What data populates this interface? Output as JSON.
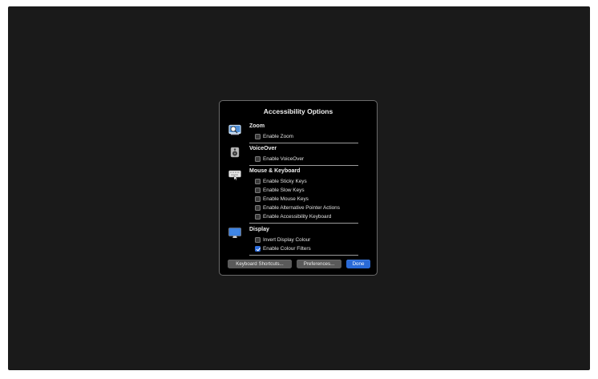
{
  "dialog": {
    "title": "Accessibility Options",
    "sections": [
      {
        "heading": "Zoom",
        "icon": "zoom-magnifier-icon",
        "options": [
          {
            "label": "Enable Zoom",
            "checked": false
          }
        ]
      },
      {
        "heading": "VoiceOver",
        "icon": "voiceover-speaker-icon",
        "options": [
          {
            "label": "Enable VoiceOver",
            "checked": false
          }
        ]
      },
      {
        "heading": "Mouse & Keyboard",
        "icon": "keyboard-mouse-icon",
        "options": [
          {
            "label": "Enable Sticky Keys",
            "checked": false
          },
          {
            "label": "Enable Slow Keys",
            "checked": false
          },
          {
            "label": "Enable Mouse Keys",
            "checked": false
          },
          {
            "label": "Enable Alternative Pointer Actions",
            "checked": false
          },
          {
            "label": "Enable Accessibility Keyboard",
            "checked": false
          }
        ]
      },
      {
        "heading": "Display",
        "icon": "display-monitor-icon",
        "options": [
          {
            "label": "Invert Display Colour",
            "checked": false
          },
          {
            "label": "Enable Colour Filters",
            "checked": true
          }
        ]
      }
    ],
    "buttons": {
      "keyboard_shortcuts": "Keyboard Shortcuts...",
      "preferences": "Preferences...",
      "done": "Done"
    }
  },
  "colors": {
    "background": "#1a1a1a",
    "dialog": "#000000",
    "accent": "#2a6ad6"
  }
}
